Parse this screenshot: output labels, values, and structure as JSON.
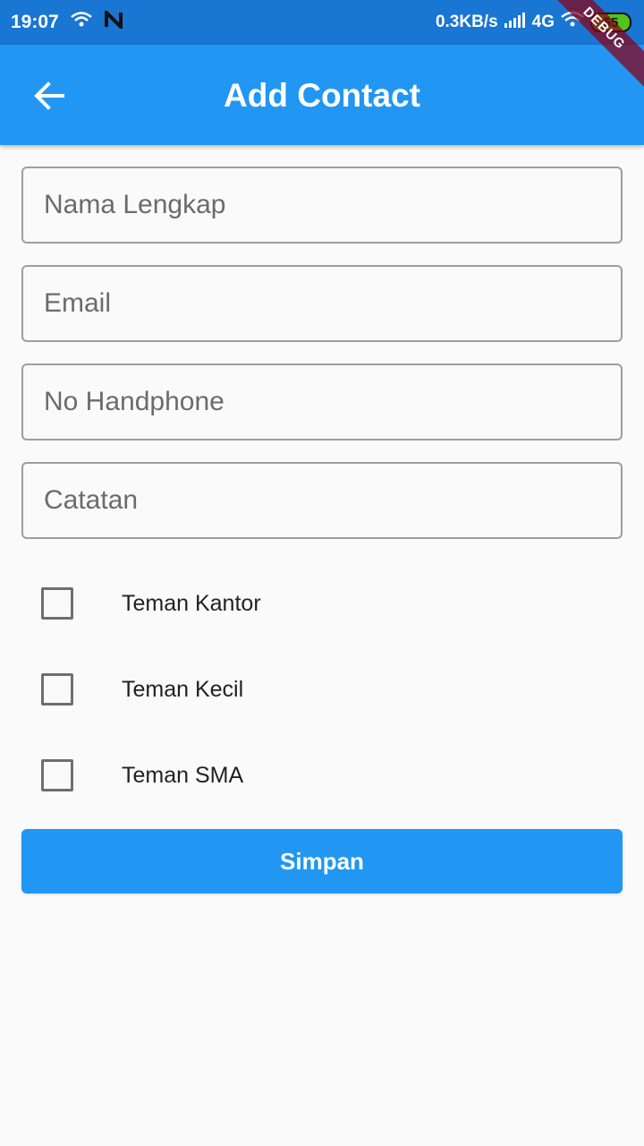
{
  "status_bar": {
    "time": "19:07",
    "speed": "0.3KB/s",
    "network": "4G",
    "battery": "55"
  },
  "app_bar": {
    "title": "Add Contact",
    "debug": "DEBUG"
  },
  "form": {
    "fields": [
      {
        "placeholder": "Nama Lengkap",
        "value": ""
      },
      {
        "placeholder": "Email",
        "value": ""
      },
      {
        "placeholder": "No Handphone",
        "value": ""
      },
      {
        "placeholder": "Catatan",
        "value": ""
      }
    ],
    "checkboxes": [
      {
        "label": "Teman Kantor",
        "checked": false
      },
      {
        "label": "Teman Kecil",
        "checked": false
      },
      {
        "label": "Teman SMA",
        "checked": false
      }
    ],
    "save_label": "Simpan"
  },
  "colors": {
    "primary": "#2196f3",
    "status_bar": "#1976d2",
    "background": "#fafafa",
    "border": "#9e9e9e"
  }
}
